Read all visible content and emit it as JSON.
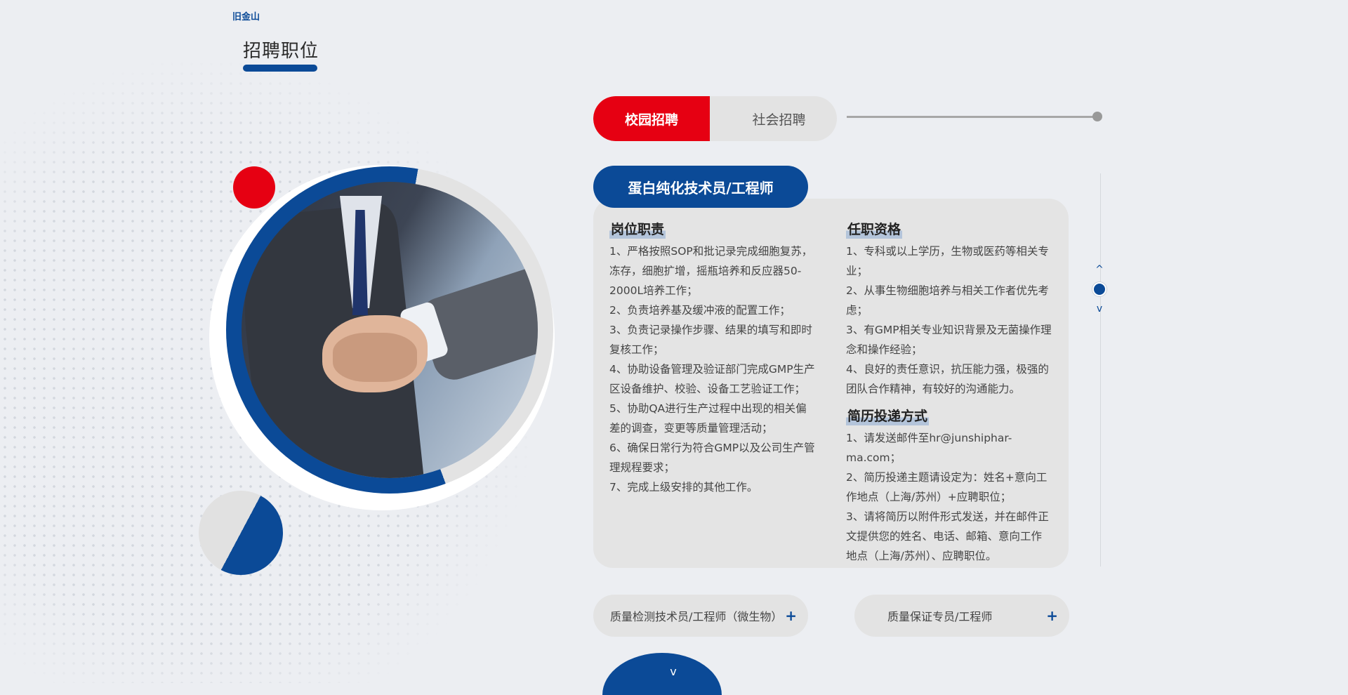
{
  "header": {
    "city": "旧金山",
    "page_title": "招聘职位"
  },
  "tabs": {
    "campus": "校园招聘",
    "social": "社会招聘",
    "active": "campus"
  },
  "job": {
    "title": "蛋白纯化技术员/工程师",
    "duties_heading": "岗位职责",
    "duties": [
      "1、严格按照SOP和批记录完成细胞复苏，冻存，细胞扩增，摇瓶培养和反应器50-2000L培养工作；",
      "2、负责培养基及缓冲液的配置工作；",
      "3、负责记录操作步骤、结果的填写和即时复核工作；",
      "4、协助设备管理及验证部门完成GMP生产区设备维护、校验、设备工艺验证工作；",
      "5、协助QA进行生产过程中出现的相关偏差的调查，变更等质量管理活动；",
      "6、确保日常行为符合GMP以及公司生产管理规程要求；",
      "7、完成上级安排的其他工作。"
    ],
    "qualifications_heading": "任职资格",
    "qualifications": [
      "1、专科或以上学历，生物或医药等相关专业；",
      "2、从事生物细胞培养与相关工作者优先考虑；",
      "3、有GMP相关专业知识背景及无菌操作理念和操作经验；",
      "4、良好的责任意识，抗压能力强，极强的团队合作精神，有较好的沟通能力。"
    ],
    "apply_heading": "简历投递方式",
    "apply": [
      "1、请发送邮件至hr@junshiphar-ma.com；",
      "2、简历投递主题请设定为：姓名+意向工作地点（上海/苏州）+应聘职位；",
      "3、请将简历以附件形式发送，并在邮件正文提供您的姓名、电话、邮箱、意向工作地点（上海/苏州）、应聘职位。"
    ]
  },
  "other_jobs": [
    {
      "label": "质量检测技术员/工程师（微生物）",
      "icon": "+"
    },
    {
      "label": "质量保证专员/工程师",
      "icon": "+"
    }
  ],
  "icons": {
    "up": "^",
    "down": "v",
    "bottom": "v"
  },
  "colors": {
    "brand_blue": "#0b4a97",
    "brand_red": "#e60012"
  }
}
